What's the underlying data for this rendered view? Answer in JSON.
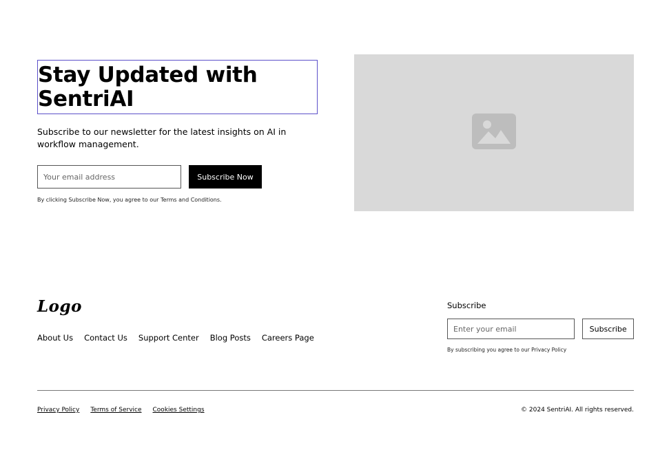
{
  "hero": {
    "title": "Stay Updated with SentriAI",
    "description": "Subscribe to our newsletter for the latest insights on AI in workflow management.",
    "email_placeholder": "Your email address",
    "subscribe_button": "Subscribe Now",
    "disclaimer": "By clicking Subscribe Now, you agree to our Terms and Conditions.",
    "image_icon": "image-placeholder-icon"
  },
  "footer": {
    "logo": "Logo",
    "nav": [
      {
        "label": "About Us"
      },
      {
        "label": "Contact Us"
      },
      {
        "label": "Support Center"
      },
      {
        "label": "Blog Posts"
      },
      {
        "label": "Careers Page"
      }
    ],
    "subscribe": {
      "heading": "Subscribe",
      "email_placeholder": "Enter your email",
      "button": "Subscribe",
      "note": "By subscribing you agree to our Privacy Policy"
    },
    "legal_links": [
      {
        "label": "Privacy Policy"
      },
      {
        "label": "Terms of Service"
      },
      {
        "label": "Cookies Settings"
      }
    ],
    "copyright": "© 2024 SentriAI. All rights reserved."
  },
  "colors": {
    "accent_outline": "#5b4fc9",
    "image_placeholder_bg": "#d9d9d9",
    "button_dark": "#000000"
  }
}
